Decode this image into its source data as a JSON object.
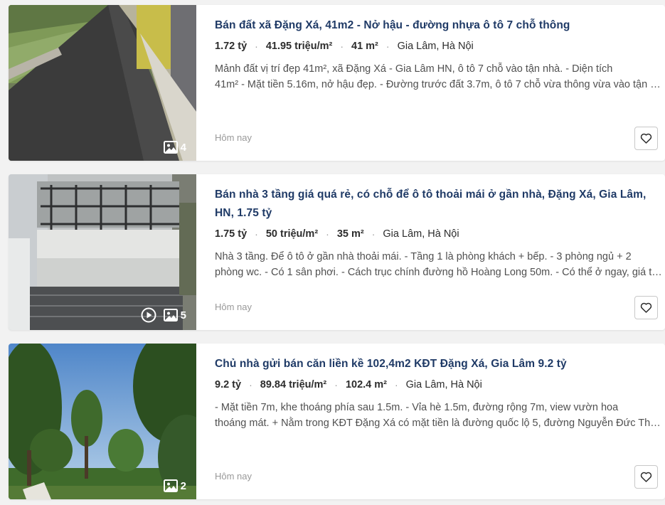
{
  "listings": [
    {
      "title": "Bán đất xã Đặng Xá, 41m2 - Nở hậu - đường nhựa ô tô 7 chỗ thông",
      "price": "1.72 tỷ",
      "price_per_m2": "41.95 triệu/m²",
      "area": "41 m²",
      "location": "Gia Lâm, Hà Nội",
      "desc_line1": "Mảnh đất vị trí đẹp 41m², xã Đặng Xá - Gia Lâm HN, ô tô 7 chỗ vào tận nhà. - Diện tích",
      "desc_line2": "41m² - Mặt tiền 5.16m, nở hậu đẹp. - Đường trước đất 3.7m, ô tô 7 chỗ vừa thông vừa vào tận nhà.",
      "date": "Hôm nay",
      "photo_count": "4",
      "has_video": false
    },
    {
      "title": "Bán nhà 3 tầng giá quá rẻ, có chỗ để ô tô thoải mái ở gần nhà, Đặng Xá, Gia Lâm, HN, 1.75 tỷ",
      "price": "1.75 tỷ",
      "price_per_m2": "50 triệu/m²",
      "area": "35 m²",
      "location": "Gia Lâm, Hà Nội",
      "desc_line1": "Nhà 3 tầng. Để ô tô ở gần nhà thoải mái. - Tầng 1 là phòng khách + bếp. - 3 phòng ngủ + 2",
      "desc_line2": "phòng wc. - Có 1 sân phơi. - Cách trục chính đường hồ Hoàng Long 50m. - Có thể ở ngay, giá tốt.",
      "date": "Hôm nay",
      "photo_count": "5",
      "has_video": true
    },
    {
      "title": "Chủ nhà gửi bán căn liền kề 102,4m2 KĐT Đặng Xá, Gia Lâm 9.2 tỷ",
      "price": "9.2 tỷ",
      "price_per_m2": "89.84 triệu/m²",
      "area": "102.4 m²",
      "location": "Gia Lâm, Hà Nội",
      "desc_line1": "- Mặt tiền 7m, khe thoáng phía sau 1.5m. - Vỉa hè 1.5m, đường rộng 7m, view vườn hoa",
      "desc_line2": "thoáng mát. + Nằm trong KĐT Đặng Xá có mặt tiền là đường quốc lộ 5, đường Nguyễn Đức Thuận.",
      "date": "Hôm nay",
      "photo_count": "2",
      "has_video": false
    }
  ],
  "colors": {
    "title": "#1f3a66",
    "page_bg": "#f2f2f2",
    "card_bg": "#ffffff",
    "muted": "#999999"
  },
  "icons": {
    "photos": "image-gallery-icon",
    "video": "play-circle-icon",
    "favorite": "heart-outline-icon"
  }
}
